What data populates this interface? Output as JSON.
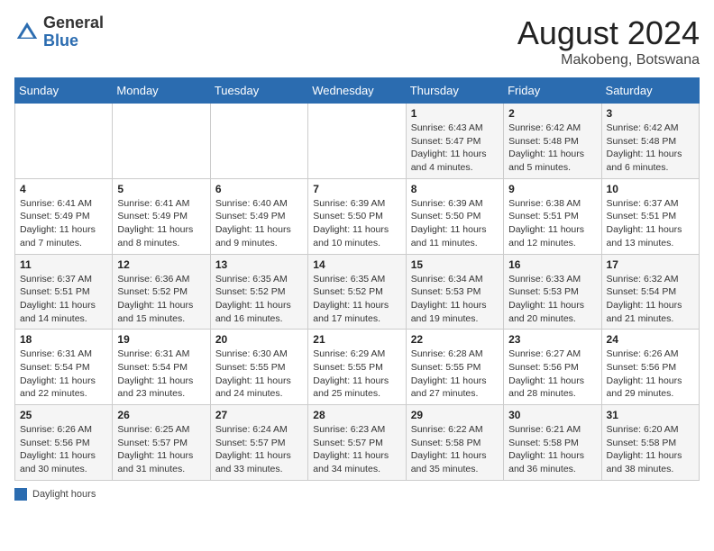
{
  "header": {
    "logo_general": "General",
    "logo_blue": "Blue",
    "month_year": "August 2024",
    "location": "Makobeng, Botswana"
  },
  "weekdays": [
    "Sunday",
    "Monday",
    "Tuesday",
    "Wednesday",
    "Thursday",
    "Friday",
    "Saturday"
  ],
  "legend_text": "Daylight hours",
  "weeks": [
    [
      {
        "day": "",
        "info": ""
      },
      {
        "day": "",
        "info": ""
      },
      {
        "day": "",
        "info": ""
      },
      {
        "day": "",
        "info": ""
      },
      {
        "day": "1",
        "info": "Sunrise: 6:43 AM\nSunset: 5:47 PM\nDaylight: 11 hours and 4 minutes."
      },
      {
        "day": "2",
        "info": "Sunrise: 6:42 AM\nSunset: 5:48 PM\nDaylight: 11 hours and 5 minutes."
      },
      {
        "day": "3",
        "info": "Sunrise: 6:42 AM\nSunset: 5:48 PM\nDaylight: 11 hours and 6 minutes."
      }
    ],
    [
      {
        "day": "4",
        "info": "Sunrise: 6:41 AM\nSunset: 5:49 PM\nDaylight: 11 hours and 7 minutes."
      },
      {
        "day": "5",
        "info": "Sunrise: 6:41 AM\nSunset: 5:49 PM\nDaylight: 11 hours and 8 minutes."
      },
      {
        "day": "6",
        "info": "Sunrise: 6:40 AM\nSunset: 5:49 PM\nDaylight: 11 hours and 9 minutes."
      },
      {
        "day": "7",
        "info": "Sunrise: 6:39 AM\nSunset: 5:50 PM\nDaylight: 11 hours and 10 minutes."
      },
      {
        "day": "8",
        "info": "Sunrise: 6:39 AM\nSunset: 5:50 PM\nDaylight: 11 hours and 11 minutes."
      },
      {
        "day": "9",
        "info": "Sunrise: 6:38 AM\nSunset: 5:51 PM\nDaylight: 11 hours and 12 minutes."
      },
      {
        "day": "10",
        "info": "Sunrise: 6:37 AM\nSunset: 5:51 PM\nDaylight: 11 hours and 13 minutes."
      }
    ],
    [
      {
        "day": "11",
        "info": "Sunrise: 6:37 AM\nSunset: 5:51 PM\nDaylight: 11 hours and 14 minutes."
      },
      {
        "day": "12",
        "info": "Sunrise: 6:36 AM\nSunset: 5:52 PM\nDaylight: 11 hours and 15 minutes."
      },
      {
        "day": "13",
        "info": "Sunrise: 6:35 AM\nSunset: 5:52 PM\nDaylight: 11 hours and 16 minutes."
      },
      {
        "day": "14",
        "info": "Sunrise: 6:35 AM\nSunset: 5:52 PM\nDaylight: 11 hours and 17 minutes."
      },
      {
        "day": "15",
        "info": "Sunrise: 6:34 AM\nSunset: 5:53 PM\nDaylight: 11 hours and 19 minutes."
      },
      {
        "day": "16",
        "info": "Sunrise: 6:33 AM\nSunset: 5:53 PM\nDaylight: 11 hours and 20 minutes."
      },
      {
        "day": "17",
        "info": "Sunrise: 6:32 AM\nSunset: 5:54 PM\nDaylight: 11 hours and 21 minutes."
      }
    ],
    [
      {
        "day": "18",
        "info": "Sunrise: 6:31 AM\nSunset: 5:54 PM\nDaylight: 11 hours and 22 minutes."
      },
      {
        "day": "19",
        "info": "Sunrise: 6:31 AM\nSunset: 5:54 PM\nDaylight: 11 hours and 23 minutes."
      },
      {
        "day": "20",
        "info": "Sunrise: 6:30 AM\nSunset: 5:55 PM\nDaylight: 11 hours and 24 minutes."
      },
      {
        "day": "21",
        "info": "Sunrise: 6:29 AM\nSunset: 5:55 PM\nDaylight: 11 hours and 25 minutes."
      },
      {
        "day": "22",
        "info": "Sunrise: 6:28 AM\nSunset: 5:55 PM\nDaylight: 11 hours and 27 minutes."
      },
      {
        "day": "23",
        "info": "Sunrise: 6:27 AM\nSunset: 5:56 PM\nDaylight: 11 hours and 28 minutes."
      },
      {
        "day": "24",
        "info": "Sunrise: 6:26 AM\nSunset: 5:56 PM\nDaylight: 11 hours and 29 minutes."
      }
    ],
    [
      {
        "day": "25",
        "info": "Sunrise: 6:26 AM\nSunset: 5:56 PM\nDaylight: 11 hours and 30 minutes."
      },
      {
        "day": "26",
        "info": "Sunrise: 6:25 AM\nSunset: 5:57 PM\nDaylight: 11 hours and 31 minutes."
      },
      {
        "day": "27",
        "info": "Sunrise: 6:24 AM\nSunset: 5:57 PM\nDaylight: 11 hours and 33 minutes."
      },
      {
        "day": "28",
        "info": "Sunrise: 6:23 AM\nSunset: 5:57 PM\nDaylight: 11 hours and 34 minutes."
      },
      {
        "day": "29",
        "info": "Sunrise: 6:22 AM\nSunset: 5:58 PM\nDaylight: 11 hours and 35 minutes."
      },
      {
        "day": "30",
        "info": "Sunrise: 6:21 AM\nSunset: 5:58 PM\nDaylight: 11 hours and 36 minutes."
      },
      {
        "day": "31",
        "info": "Sunrise: 6:20 AM\nSunset: 5:58 PM\nDaylight: 11 hours and 38 minutes."
      }
    ]
  ]
}
